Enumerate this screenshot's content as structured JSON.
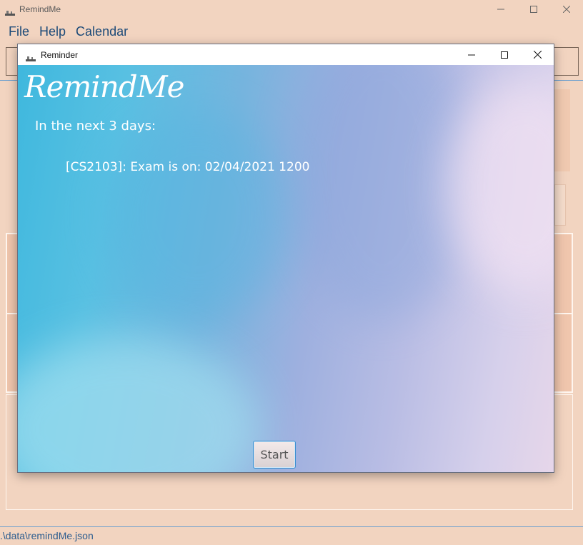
{
  "main_window": {
    "title": "RemindMe",
    "controls": {
      "minimize": "—",
      "maximize": "☐",
      "close": "✕"
    }
  },
  "menu": {
    "items": [
      "File",
      "Help",
      "Calendar"
    ]
  },
  "status_bar": {
    "path": ".\\data\\remindMe.json"
  },
  "dialog": {
    "title": "Reminder",
    "logo": "RemindMe",
    "heading": "In the next 3 days:",
    "reminders": [
      "[CS2103]: Exam is on: 02/04/2021 1200"
    ],
    "start_label": "Start"
  },
  "colors": {
    "main_background": "#f2d4c0",
    "menu_text": "#1c4a78",
    "status_text": "#2c5d8f",
    "dialog_gradient_start": "#3fb8de",
    "dialog_gradient_end": "#e6d6ea"
  }
}
